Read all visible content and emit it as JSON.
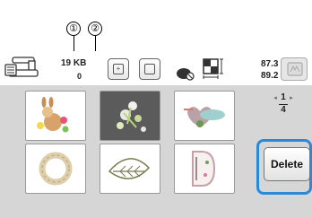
{
  "callouts": {
    "c1": "①",
    "c2": "②"
  },
  "memory": {
    "used": "19 KB",
    "free": "0"
  },
  "size": {
    "width": "87.3 mm",
    "height": "89.2 mm"
  },
  "icons": {
    "machine": "sewing-machine-icon",
    "memory_card": "memory-card-icon",
    "frame": "embroidery-frame-icon"
  },
  "pager": {
    "current": "1",
    "total": "4"
  },
  "delete_label": "Delete",
  "patterns": [
    {
      "name": "bunny-flower",
      "selected": false
    },
    {
      "name": "floral-dark",
      "selected": true
    },
    {
      "name": "hearts-ribbon",
      "selected": false
    },
    {
      "name": "wreath",
      "selected": false
    },
    {
      "name": "leaf",
      "selected": false
    },
    {
      "name": "letter-d",
      "selected": false
    }
  ]
}
